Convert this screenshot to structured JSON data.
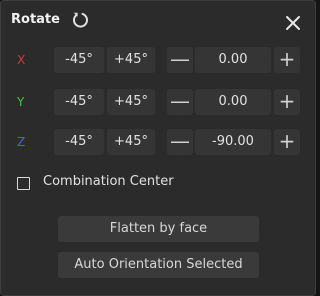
{
  "panel": {
    "title": "Rotate",
    "reset_icon": "rotate-reset-icon",
    "close_icon": "close-icon"
  },
  "rows": [
    {
      "axis": "X",
      "minus45": "-45°",
      "plus45": "+45°",
      "decrement": "—",
      "value": "0.00",
      "increment": "+"
    },
    {
      "axis": "Y",
      "minus45": "-45°",
      "plus45": "+45°",
      "decrement": "—",
      "value": "0.00",
      "increment": "+"
    },
    {
      "axis": "Z",
      "minus45": "-45°",
      "plus45": "+45°",
      "decrement": "—",
      "value": "-90.00",
      "increment": "+"
    }
  ],
  "axis_colors": {
    "X": "#d13a3a",
    "Y": "#3ec83e",
    "Z": "#4a63e6"
  },
  "combination_center": {
    "label": "Combination Center",
    "checked": false
  },
  "actions": {
    "flatten_label": "Flatten by face",
    "auto_orient_label": "Auto Orientation Selected"
  }
}
